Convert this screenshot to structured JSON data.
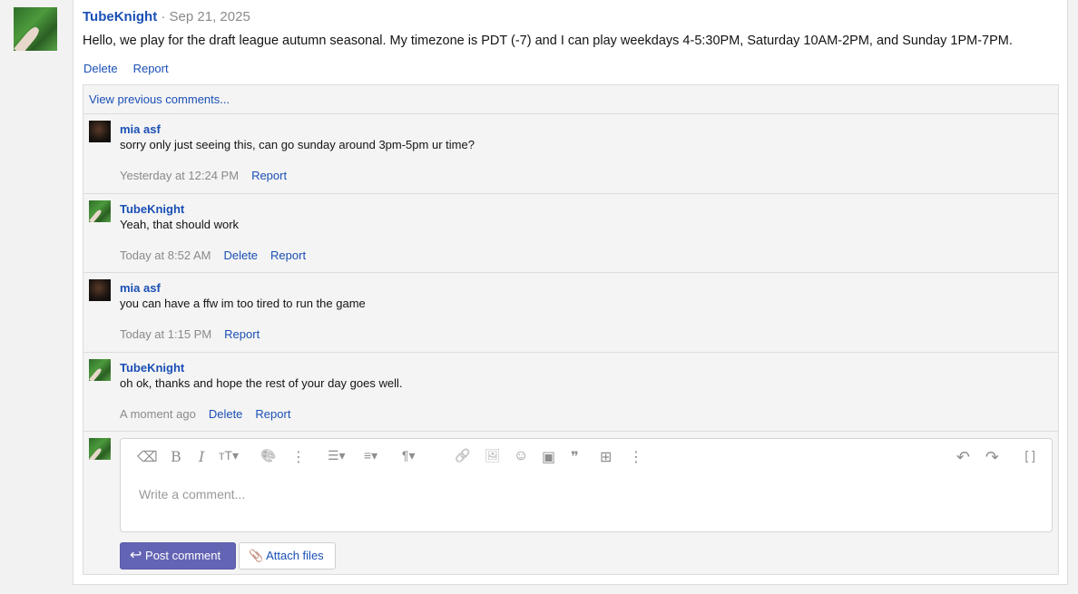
{
  "post": {
    "author": "TubeKnight",
    "date": "· Sep 21, 2025",
    "body": "Hello, we play for the draft league autumn seasonal. My timezone is PDT (-7) and I can play weekdays 4-5:30PM, Saturday 10AM-2PM, and Sunday 1PM-7PM.",
    "delete": "Delete",
    "report": "Report"
  },
  "view_previous": "View previous comments...",
  "comments": [
    {
      "author": "mia asf",
      "text": "sorry only just seeing this, can go sunday around 3pm-5pm ur time?",
      "time": "Yesterday at 12:24 PM",
      "report": "Report"
    },
    {
      "author": "TubeKnight",
      "text": "Yeah, that should work",
      "time": "Today at 8:52 AM",
      "delete": "Delete",
      "report": "Report"
    },
    {
      "author": "mia asf",
      "text": "you can have a ffw im too tired to run the game",
      "time": "Today at 1:15 PM",
      "report": "Report"
    },
    {
      "author": "TubeKnight",
      "text": "oh ok, thanks and hope the rest of your day goes well.",
      "time": "A moment ago",
      "delete": "Delete",
      "report": "Report"
    }
  ],
  "editor": {
    "placeholder": "Write a comment...",
    "post_label": "Post comment",
    "attach_label": "Attach files",
    "toolbar": {
      "eraser": "⌫",
      "bold": "B",
      "italic": "I",
      "text_size": "тT▾",
      "palette": "🎨",
      "more": "⋮",
      "list": "☰▾",
      "align": "≡▾",
      "paragraph": "¶▾",
      "link": "🔗",
      "image": "🖼",
      "emoji": "☺",
      "gallery": "▣",
      "quote": "❞",
      "table": "⊞",
      "more2": "⋮",
      "undo": "↶",
      "redo": "↷",
      "fullscreen": "[ ]"
    },
    "post_icon": "↩",
    "attach_icon": "📎"
  }
}
